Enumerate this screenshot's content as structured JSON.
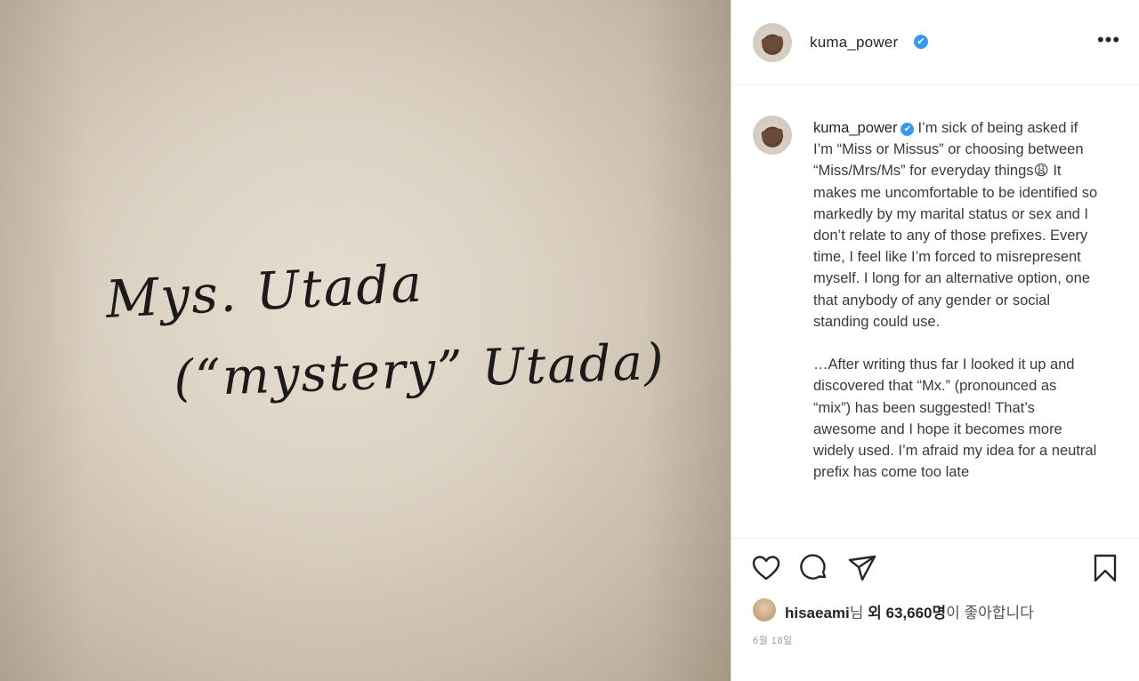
{
  "post": {
    "username": "kuma_power",
    "verified_symbol": "✔",
    "handwriting_line1": "Mys. Utada",
    "handwriting_line2": "(“mystery” Utada)",
    "caption": "I’m sick of being asked if I’m “Miss or Missus” or choosing between “Miss/Mrs/Ms” for everyday things😩 It makes me uncomfortable to be identified so markedly by my marital status or sex and I don’t relate to any of those prefixes. Every time, I feel like I’m forced to misrepresent myself. I long for an alternative option, one that anybody of any gender or social standing could use.\n\n…After writing thus far I looked it up and discovered that “Mx.” (pronounced as “mix”) has been suggested! That’s awesome and I hope it becomes more widely used. I’m afraid my idea for a neutral prefix has come too late"
  },
  "header": {
    "more_label": "•••"
  },
  "actions": {
    "like_icon": "heart-icon",
    "comment_icon": "comment-icon",
    "share_icon": "share-icon",
    "save_icon": "bookmark-icon"
  },
  "likes": {
    "liker": "hisaeami",
    "suffix_nim": "님 ",
    "oe": "외",
    "count": "63,660명",
    "tail": "이 좋아합니다"
  },
  "date_text": "6월 18일",
  "colors": {
    "verified_blue": "#3897f0",
    "text_primary": "#262626",
    "ink": "#1c1a1a"
  }
}
